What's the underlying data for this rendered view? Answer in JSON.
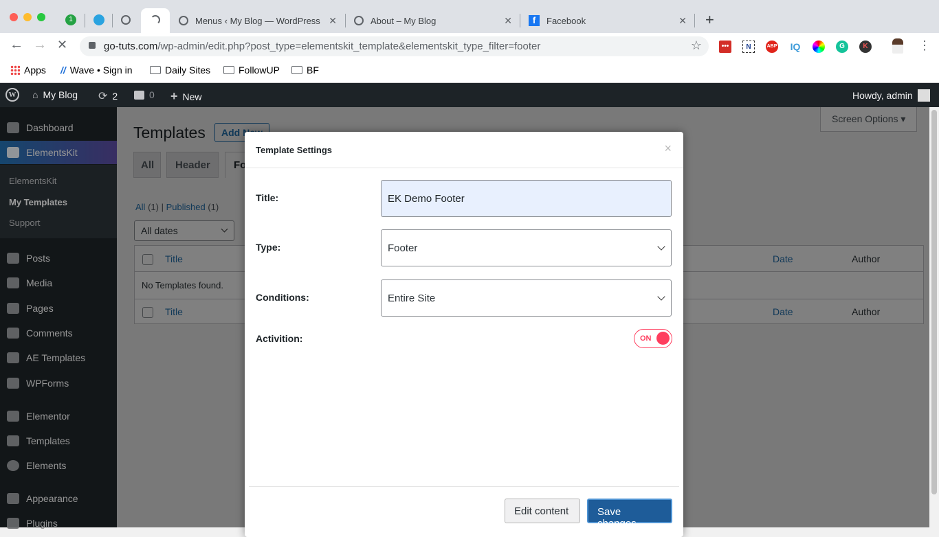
{
  "browser": {
    "tabs": [
      {
        "label": "Menus ‹ My Blog — WordPress"
      },
      {
        "label": "About – My Blog"
      },
      {
        "label": "Facebook"
      }
    ],
    "pinned_badge": "1",
    "url_host": "go-tuts.com",
    "url_path": "/wp-admin/edit.php?post_type=elementskit_template&elementskit_type_filter=footer",
    "extensions": [
      "lastpass-icon",
      "nimbus-icon",
      "adblock-icon",
      "iq-icon",
      "color-picker-icon",
      "grammarly-icon",
      "k-icon"
    ],
    "ext_labels": {
      "abp": "ABP",
      "iq": "IQ",
      "k": "K",
      "n": "N",
      "g": "G"
    },
    "bookmarks": [
      {
        "label": "Apps"
      },
      {
        "label": "Wave • Sign in"
      },
      {
        "label": "Daily Sites"
      },
      {
        "label": "FollowUP"
      },
      {
        "label": "BF"
      }
    ]
  },
  "adminbar": {
    "site": "My Blog",
    "updates": "2",
    "comments": "0",
    "new": "New",
    "howdy": "Howdy, admin"
  },
  "sidebar": {
    "items": [
      {
        "label": "Dashboard"
      },
      {
        "label": "ElementsKit"
      },
      {
        "label": "Posts"
      },
      {
        "label": "Media"
      },
      {
        "label": "Pages"
      },
      {
        "label": "Comments"
      },
      {
        "label": "AE Templates"
      },
      {
        "label": "WPForms"
      },
      {
        "label": "Elementor"
      },
      {
        "label": "Templates"
      },
      {
        "label": "Elements"
      },
      {
        "label": "Appearance"
      },
      {
        "label": "Plugins"
      }
    ],
    "submenu": [
      {
        "label": "ElementsKit"
      },
      {
        "label": "My Templates"
      },
      {
        "label": "Support"
      }
    ],
    "active_color": "#2271b1"
  },
  "page": {
    "title": "Templates",
    "add_new": "Add New",
    "screen_options": "Screen Options ▾",
    "tabs": [
      "All",
      "Header",
      "Footer"
    ],
    "filters": {
      "all": "All",
      "all_count": "(1)",
      "sep": "|",
      "published": "Published",
      "published_count": "(1)"
    },
    "dates": "All dates",
    "columns": {
      "title": "Title",
      "date": "Date",
      "author": "Author"
    },
    "empty": "No Templates found."
  },
  "modal": {
    "heading": "Template Settings",
    "close": "×",
    "title_label": "Title:",
    "title_value": "EK Demo Footer",
    "type_label": "Type:",
    "type_value": "Footer",
    "conditions_label": "Conditions:",
    "conditions_value": "Entire Site",
    "activation_label": "Activition:",
    "toggle": "ON",
    "toggle_on": true,
    "toggle_color": "#ff3d5e",
    "edit_content": "Edit content",
    "save_changes": "Save changes"
  }
}
